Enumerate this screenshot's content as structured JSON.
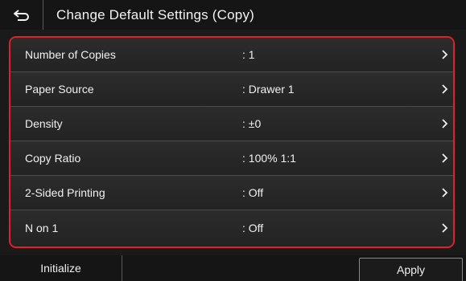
{
  "header": {
    "title": "Change Default Settings (Copy)",
    "back_icon": "back-arrow-icon"
  },
  "settings": [
    {
      "label": "Number of Copies",
      "value": ": 1"
    },
    {
      "label": "Paper Source",
      "value": ": Drawer 1"
    },
    {
      "label": "Density",
      "value": ": ±0"
    },
    {
      "label": "Copy Ratio",
      "value": ": 100% 1:1"
    },
    {
      "label": "2-Sided Printing",
      "value": ": Off"
    },
    {
      "label": "N on 1",
      "value": ": Off"
    }
  ],
  "footer": {
    "initialize_label": "Initialize",
    "apply_label": "Apply"
  },
  "colors": {
    "selection_border": "#e0202a",
    "background": "#1a1a1a",
    "text": "#f0f0f0"
  }
}
